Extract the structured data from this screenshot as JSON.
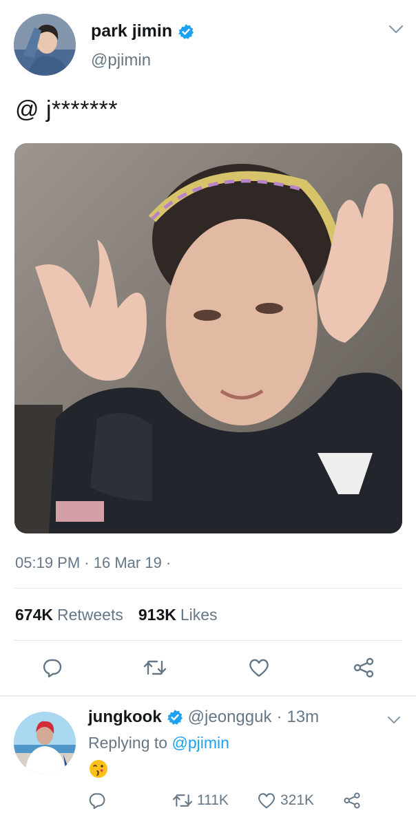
{
  "tweet": {
    "display_name": "park jimin",
    "handle": "@pjimin",
    "text": "@ j*******",
    "time": "05:19 PM",
    "date": "16 Mar 19",
    "meta_separator": "·",
    "retweets_count": "674K",
    "retweets_label": "Retweets",
    "likes_count": "913K",
    "likes_label": "Likes"
  },
  "reply": {
    "display_name": "jungkook",
    "handle": "@jeongguk",
    "separator": "·",
    "time": "13m",
    "replying_prefix": "Replying to",
    "replying_to": "@pjimin",
    "retweets": "111K",
    "likes": "321K"
  },
  "colors": {
    "verified_blue": "#1da1f2",
    "secondary_text": "#657786",
    "link": "#1da1f2"
  },
  "icons": [
    "verified-badge-icon",
    "chevron-down-icon",
    "reply-icon",
    "retweet-icon",
    "like-icon",
    "share-icon",
    "kissing-face-emoji"
  ]
}
